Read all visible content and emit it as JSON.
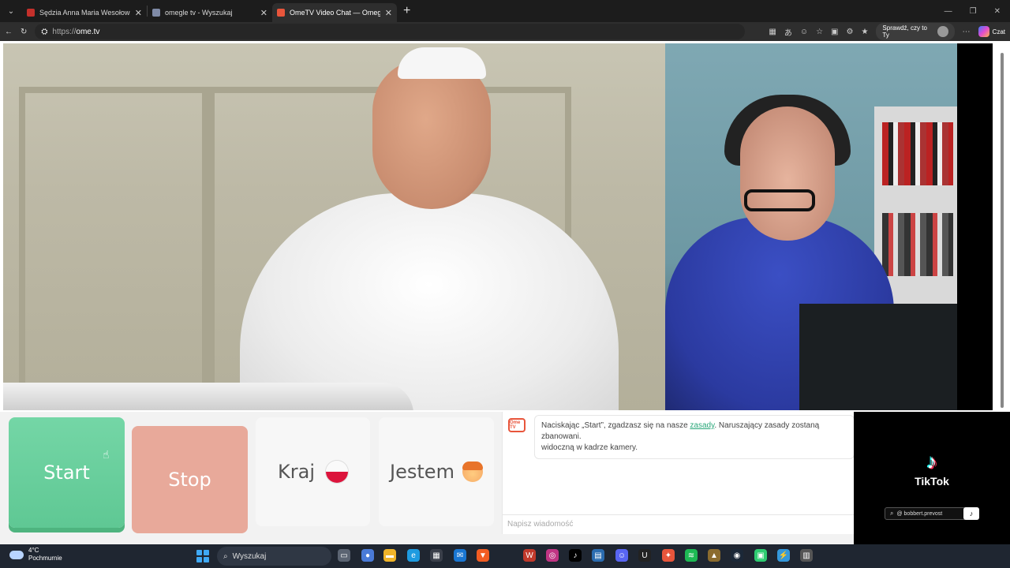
{
  "browser": {
    "tabs": [
      {
        "label": "Sędzia Anna Maria Wesołowska o",
        "favicon_color": "#c4302b",
        "active": false
      },
      {
        "label": "omegle tv - Wyszukaj",
        "favicon_color": "#7f8aa6",
        "active": false
      },
      {
        "label": "OmeTV Video Chat — Omegle",
        "favicon_color": "#e8553b",
        "active": true
      }
    ],
    "url_proto": "https://",
    "url_host": "ome.tv",
    "check_label": "Sprawdź, czy to Ty",
    "copilot_label": "Czat"
  },
  "controls": {
    "start_label": "Start",
    "stop_label": "Stop",
    "country_label": "Kraj",
    "gender_label": "Jestem"
  },
  "chat": {
    "logo_text": "Ome TV",
    "message_prefix": "Naciskając „Start”, zgadzasz się na nasze ",
    "message_link": "zasady",
    "message_suffix": ". Naruszający zasady zostaną zbanowani.",
    "message_line2": "widoczną w kadrze kamery.",
    "input_placeholder": "Napisz wiadomość"
  },
  "overlay": {
    "brand": "TikTok",
    "handle": "@ bobbert.prevost"
  },
  "taskbar": {
    "temperature": "4°C",
    "weather": "Pochmurnie",
    "search_placeholder": "Wyszukaj"
  },
  "colors": {
    "start": "#5fc894",
    "stop": "#e8a99a",
    "accent": "#2aa77a"
  }
}
